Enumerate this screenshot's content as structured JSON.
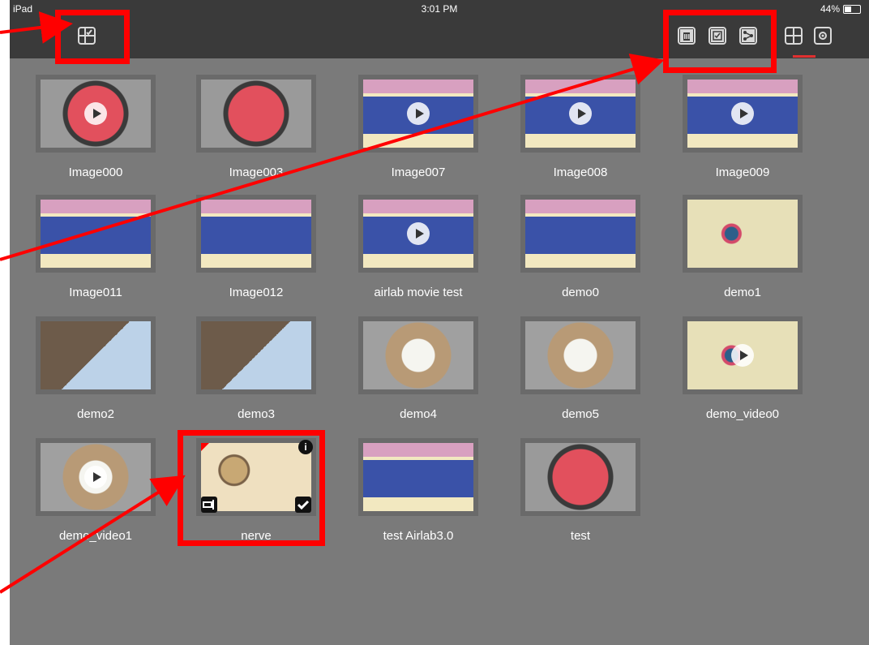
{
  "status_bar": {
    "device": "iPad",
    "time": "3:01 PM",
    "battery": "44%"
  },
  "toolbar": {
    "select_icon": "select-grid-icon",
    "actions": [
      "trash-icon",
      "select-all-icon",
      "share-icon"
    ],
    "view_modes": [
      "grid-view-icon",
      "camera-view-icon"
    ]
  },
  "gallery": {
    "items": [
      {
        "label": "Image000",
        "kind": "camera",
        "video": true
      },
      {
        "label": "Image003",
        "kind": "camera",
        "video": false
      },
      {
        "label": "Image007",
        "kind": "tissue",
        "video": true
      },
      {
        "label": "Image008",
        "kind": "tissue",
        "video": true
      },
      {
        "label": "Image009",
        "kind": "tissue",
        "video": true
      },
      {
        "label": "Image011",
        "kind": "tissue",
        "video": false
      },
      {
        "label": "Image012",
        "kind": "tissue",
        "video": false
      },
      {
        "label": "airlab movie test",
        "kind": "tissue",
        "video": true
      },
      {
        "label": "demo0",
        "kind": "tissue",
        "video": false
      },
      {
        "label": "demo1",
        "kind": "cells",
        "video": false
      },
      {
        "label": "demo2",
        "kind": "insect",
        "video": false
      },
      {
        "label": "demo3",
        "kind": "insect",
        "video": false
      },
      {
        "label": "demo4",
        "kind": "starfish",
        "video": false
      },
      {
        "label": "demo5",
        "kind": "starfish",
        "video": false
      },
      {
        "label": "demo_video0",
        "kind": "cells",
        "video": true
      },
      {
        "label": "demo_video1",
        "kind": "starfish",
        "video": true
      },
      {
        "label": "nerve",
        "kind": "nerve",
        "video": false,
        "selected": true
      },
      {
        "label": "test Airlab3.0",
        "kind": "tissue",
        "video": false
      },
      {
        "label": "test",
        "kind": "camera",
        "video": false
      }
    ]
  },
  "colors": {
    "annotation": "#ff0000",
    "background": "#7a7a7a",
    "toolbar": "#3a3a3a"
  }
}
